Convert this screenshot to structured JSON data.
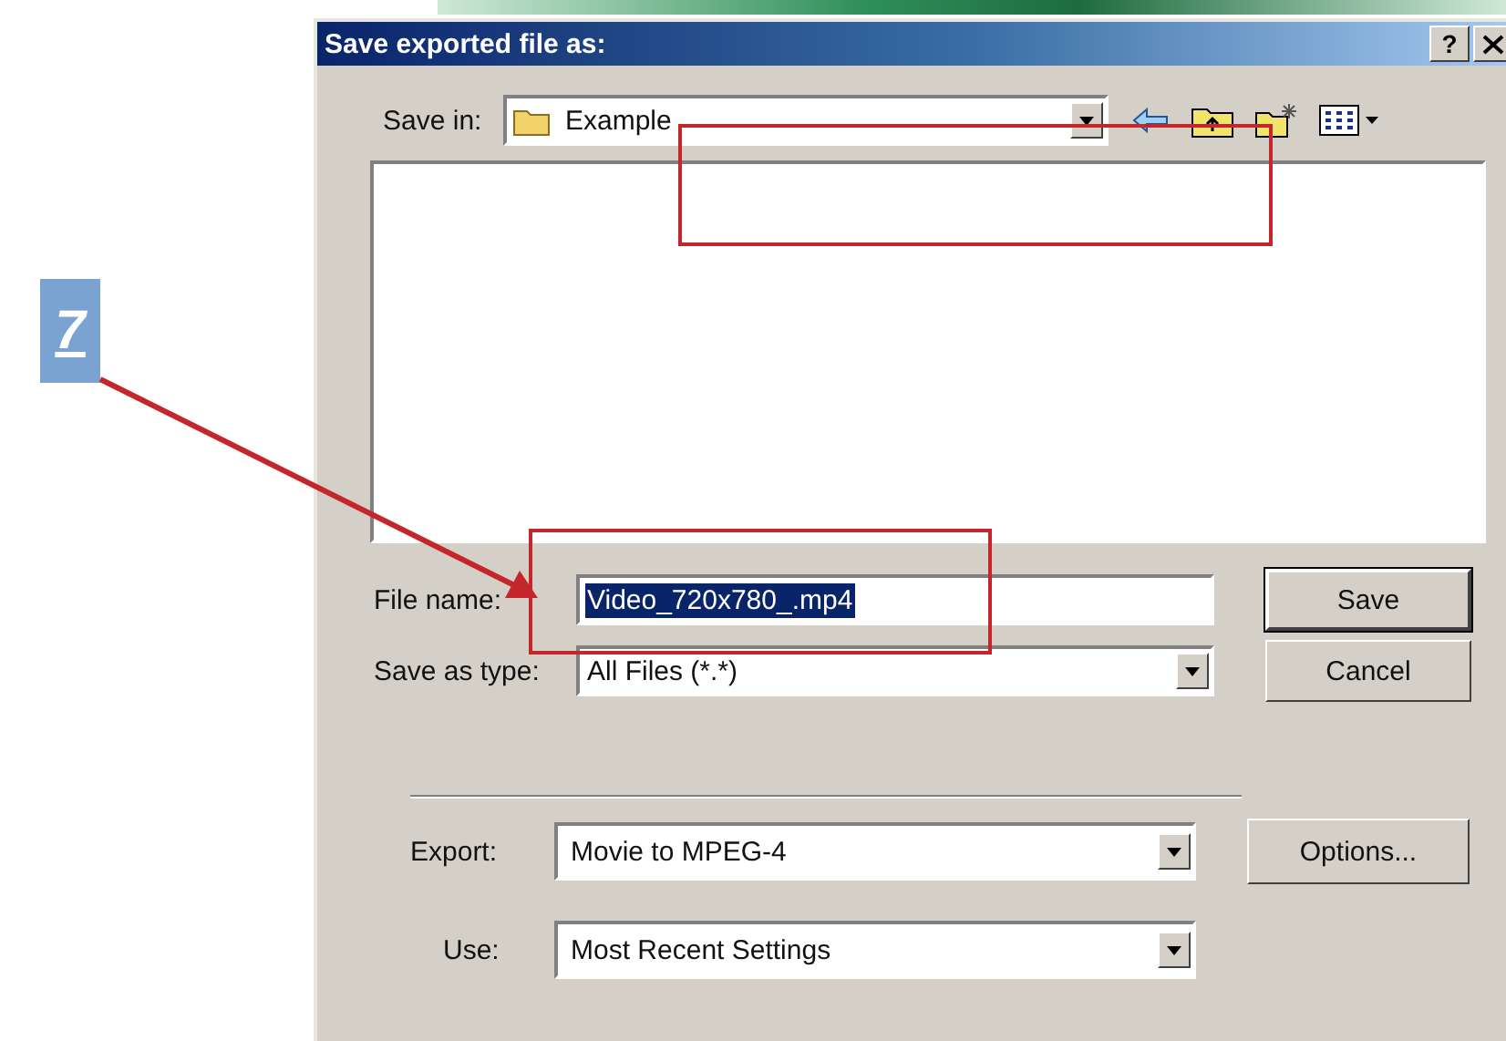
{
  "callout": {
    "number": "7"
  },
  "dialog": {
    "title": "Save exported file as:",
    "help_button": "?",
    "save_in": {
      "label": "Save in:",
      "value": "Example"
    },
    "file_name": {
      "label": "File name:",
      "value": "Video_720x780_.mp4",
      "selected": true
    },
    "save_as_type": {
      "label": "Save as type:",
      "value": "All Files (*.*)"
    },
    "buttons": [
      {
        "label": "Save",
        "default": true
      },
      {
        "label": "Cancel",
        "default": false
      }
    ],
    "export": {
      "label": "Export:",
      "value": "Movie to MPEG-4"
    },
    "options_button": "Options...",
    "use": {
      "label": "Use:",
      "value": "Most Recent Settings"
    }
  }
}
